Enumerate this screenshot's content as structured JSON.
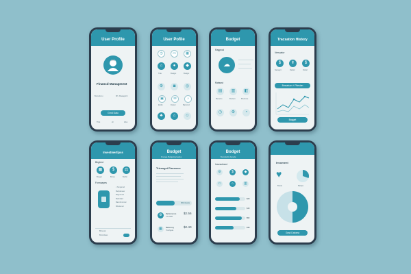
{
  "colors": {
    "background": "#8fbfcb",
    "accent": "#2e97ad",
    "phone": "#2c3d4d",
    "screen": "#eef3f4"
  },
  "p1": {
    "header": "User Profile",
    "title": "Financd Managment",
    "stat_left": "Bemotionu",
    "stat_right": "Mh. Maaagetrit",
    "button": "Grnd Datu",
    "tab_left": "That",
    "tab_mid": "eh",
    "tab_right": "lolus"
  },
  "p2": {
    "header": "User Pofile",
    "labels": [
      "Tide",
      "Budget",
      "Budget",
      "Eddin",
      "Dostor",
      "Bankrod"
    ]
  },
  "p3": {
    "header": "Budget",
    "label1": "Ragprod",
    "label2": "Matsast",
    "labels": [
      "Bucarns",
      "Buctam",
      "Brutinme"
    ]
  },
  "p4": {
    "header": "Tracsation History",
    "subtitle": "Versuator",
    "labels": [
      "Naowgrt",
      "Dadiel",
      "Dobel"
    ],
    "button_top": "Bmsaison + Pitesian",
    "button_bottom": "Bagget"
  },
  "p5": {
    "header": "Investmertipss",
    "label1": "Bhgtred",
    "label2": "Fonnaapes",
    "labels": [
      "Burget",
      "Bureu",
      "Berbir"
    ],
    "items": [
      "Tompsrnd",
      "Buhplaneer",
      "Bsgmrnod",
      "Bstlrnlaid",
      "Bannbnotmal",
      "Bhotkonol"
    ],
    "footer1": "Bhnoust",
    "footer2": "Brownfaas"
  },
  "p6": {
    "header": "Budget",
    "subheader": "Finanga Budgeting leadus",
    "title": "Triesuget Plaeeneer",
    "button": "Mbtntnpoia",
    "rows": [
      {
        "label": "Rehonnamcs",
        "sub": "3 1/2200",
        "value": "$2.56"
      },
      {
        "label": "Bedenong",
        "sub": "Trenfgeta",
        "value": "$2.40"
      }
    ]
  },
  "p7": {
    "header": "Bodget",
    "subheader": "Bumrelerlis haneda",
    "label": "Imvesctmect",
    "bar_values": [
      "$29",
      "$15",
      "$52",
      "$38"
    ],
    "bar_levels": [
      0.82,
      0.7,
      0.88,
      0.62
    ]
  },
  "p8": {
    "header": "",
    "title": "Invoment",
    "labels": [
      "Brade",
      "Baidpe"
    ],
    "button": "Grad Datoma"
  }
}
